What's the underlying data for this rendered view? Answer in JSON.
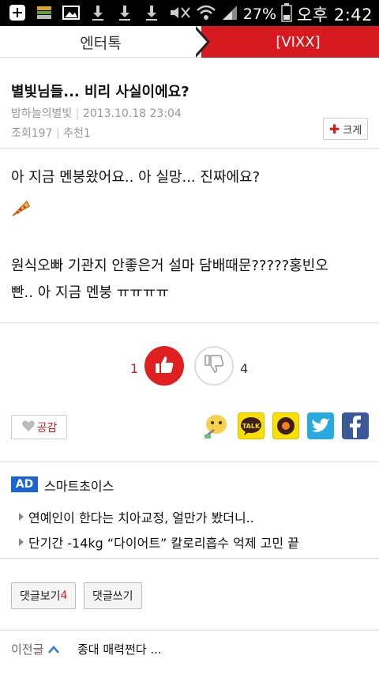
{
  "statusbar": {
    "battery": "27%",
    "time": "오후 2:42",
    "icons": [
      "add-icon",
      "notes-icon",
      "image-icon",
      "download-icon",
      "download-icon",
      "download-icon",
      "mute-icon",
      "wifi-icon",
      "signal-icon",
      "battery-icon"
    ]
  },
  "nav": {
    "left_label": "엔터톡",
    "right_label": "[VIXX]"
  },
  "post": {
    "title": "별빛님들... 비리 사실이에요?",
    "author": "밤하늘의별빛",
    "date": "2013.10.18 23:04",
    "views": "조회197",
    "recommend": "추천1",
    "size_label": "크게"
  },
  "body": {
    "line1": "아 지금 멘붕왔어요.. 아 실망... 진짜에요?",
    "line2": "원식오빠 기관지 안좋은거 설마 담배때문?????홍빈오",
    "line3": "빤.. 아 지금 멘붕 ㅠㅠㅠㅠ"
  },
  "votes": {
    "like_count": "1",
    "dislike_count": "4"
  },
  "empathy": {
    "label": "공감"
  },
  "share": {
    "icons": [
      "kakaostory-icon",
      "kakaotalk-icon",
      "kakao-icon",
      "twitter-icon",
      "facebook-icon"
    ],
    "talk_label": "TALK"
  },
  "ad": {
    "badge": "AD",
    "title": "스마트초이스",
    "items": [
      "연예인이 한다는 치아교정, 얼만가 봤더니..",
      "단기간 -14kg “다이어트” 칼로리흡수 억제 고민 끝"
    ]
  },
  "comments": {
    "view_label": "댓글보기",
    "view_count": "4",
    "write_label": "댓글쓰기"
  },
  "prev": {
    "label": "이전글",
    "title": "종대 매력쩐다 ..."
  },
  "colors": {
    "accent_red": "#d71920",
    "ad_blue": "#1b64d8",
    "twitter": "#2aa9e0",
    "facebook": "#3b5998",
    "kakao_yellow": "#f9e000"
  }
}
